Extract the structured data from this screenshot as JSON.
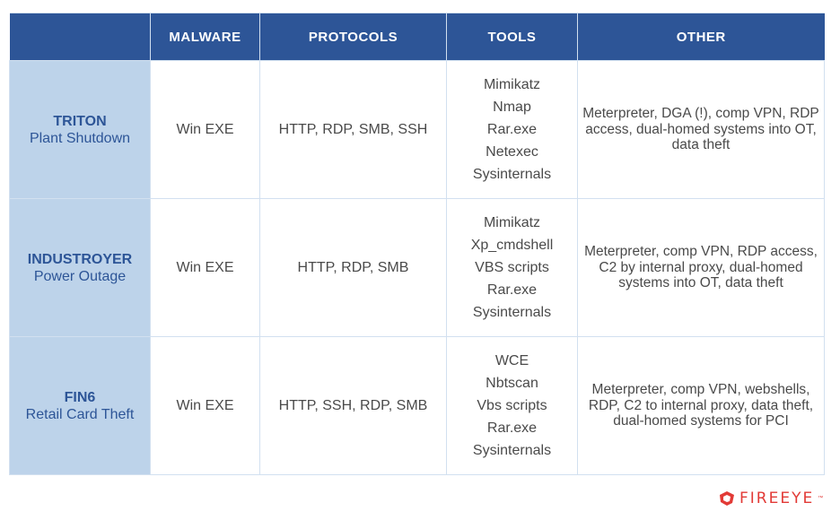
{
  "table": {
    "headers": [
      "",
      "MALWARE",
      "PROTOCOLS",
      "TOOLS",
      "OTHER"
    ],
    "rows": [
      {
        "name": "TRITON",
        "subtitle": "Plant Shutdown",
        "malware": "Win EXE",
        "protocols": "HTTP, RDP, SMB, SSH",
        "tools": [
          "Mimikatz",
          "Nmap",
          "Rar.exe",
          "Netexec",
          "Sysinternals"
        ],
        "other": "Meterpreter, DGA (!), comp VPN, RDP access, dual-homed systems into OT, data theft"
      },
      {
        "name": "INDUSTROYER",
        "subtitle": "Power Outage",
        "malware": "Win EXE",
        "protocols": "HTTP, RDP, SMB",
        "tools": [
          "Mimikatz",
          "Xp_cmdshell",
          "VBS scripts",
          "Rar.exe",
          "Sysinternals"
        ],
        "other": "Meterpreter, comp VPN, RDP access, C2 by internal proxy, dual-homed systems into OT, data theft"
      },
      {
        "name": "FIN6",
        "subtitle": "Retail Card Theft",
        "malware": "Win EXE",
        "protocols": "HTTP, SSH, RDP, SMB",
        "tools": [
          "WCE",
          "Nbtscan",
          "Vbs scripts",
          "Rar.exe",
          "Sysinternals"
        ],
        "other": "Meterpreter, comp VPN, webshells, RDP, C2 to internal proxy, data theft, dual-homed systems for PCI"
      }
    ]
  },
  "logo": {
    "icon": "fireeye-logo-icon",
    "text": "FIREEYE",
    "trademark": "™"
  },
  "colors": {
    "header_bg": "#2d5597",
    "name_col_bg": "#bdd3ea",
    "name_text": "#2d5597",
    "body_text": "#4a4a4a",
    "logo_red": "#e23a36"
  }
}
